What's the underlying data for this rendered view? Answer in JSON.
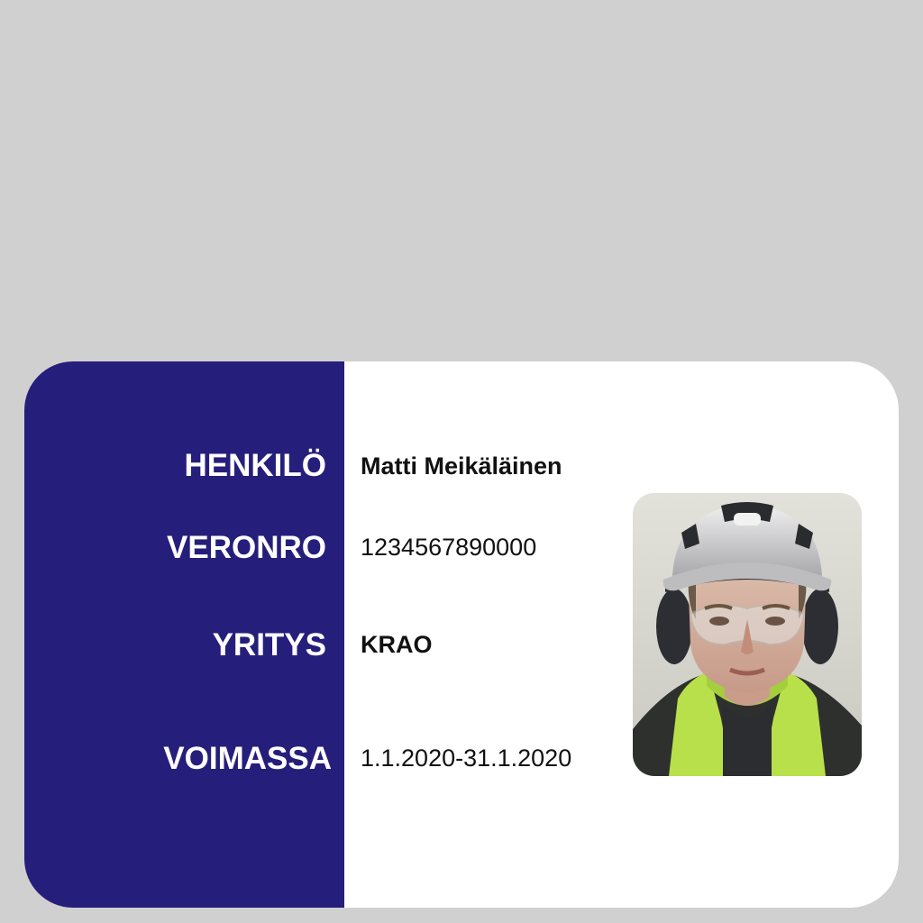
{
  "card": {
    "fields": [
      {
        "label": "HENKILÖ",
        "value": "Matti Meikäläinen"
      },
      {
        "label": "VERONRO",
        "value": "1234567890000"
      },
      {
        "label": "YRITYS",
        "value": "KRAO"
      },
      {
        "label": "VOIMASSA",
        "value": "1.1.2020-31.1.2020"
      }
    ],
    "photo_icon": "worker-portrait",
    "colors": {
      "label_panel": "#261e7b",
      "card_background": "#ffffff",
      "page_background": "#d0d0d0",
      "vest": "#b8e04a"
    }
  }
}
